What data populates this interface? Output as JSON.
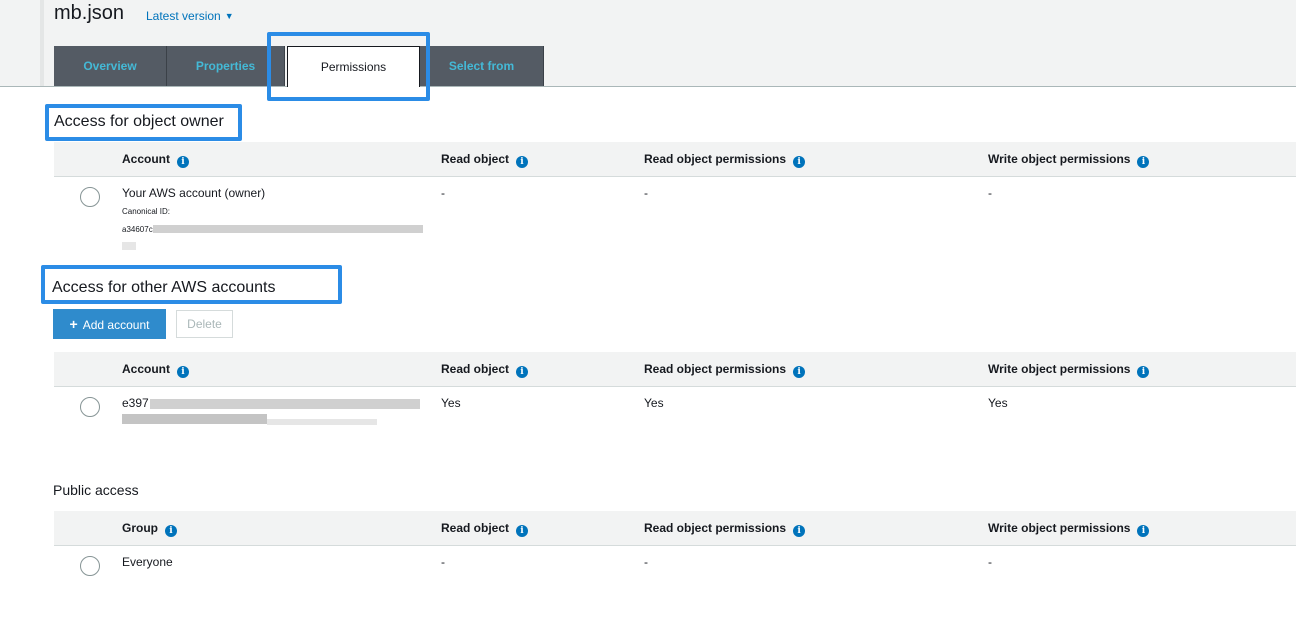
{
  "object": {
    "name": "mb.json",
    "version_label": "Latest version"
  },
  "tabs": [
    {
      "label": "Overview"
    },
    {
      "label": "Properties"
    },
    {
      "label": "Permissions"
    },
    {
      "label": "Select from"
    }
  ],
  "colors": {
    "highlight": "#2b8ce6",
    "tab_bg": "#545b64",
    "tab_text": "#44b9d6",
    "primary_button": "#2f8bcc",
    "info_icon": "#0073bb"
  },
  "owner_section": {
    "title": "Access for object owner",
    "columns": [
      "Account",
      "Read object",
      "Read object permissions",
      "Write object permissions"
    ],
    "rows": [
      {
        "account": "Your AWS account (owner)",
        "canonical_label": "Canonical ID:",
        "canonical_prefix": "a34607c",
        "read_object": "-",
        "read_permissions": "-",
        "write_permissions": "-"
      }
    ]
  },
  "other_section": {
    "title": "Access for other AWS accounts",
    "add_button": "Add account",
    "delete_button": "Delete",
    "columns": [
      "Account",
      "Read object",
      "Read object permissions",
      "Write object permissions"
    ],
    "rows": [
      {
        "account_prefix": "e397",
        "read_object": "Yes",
        "read_permissions": "Yes",
        "write_permissions": "Yes"
      }
    ]
  },
  "public_section": {
    "title": "Public access",
    "columns": [
      "Group",
      "Read object",
      "Read object permissions",
      "Write object permissions"
    ],
    "rows": [
      {
        "group": "Everyone",
        "read_object": "-",
        "read_permissions": "-",
        "write_permissions": "-"
      }
    ]
  },
  "icons": {
    "info": "i",
    "caret": "▼",
    "plus": "+"
  }
}
